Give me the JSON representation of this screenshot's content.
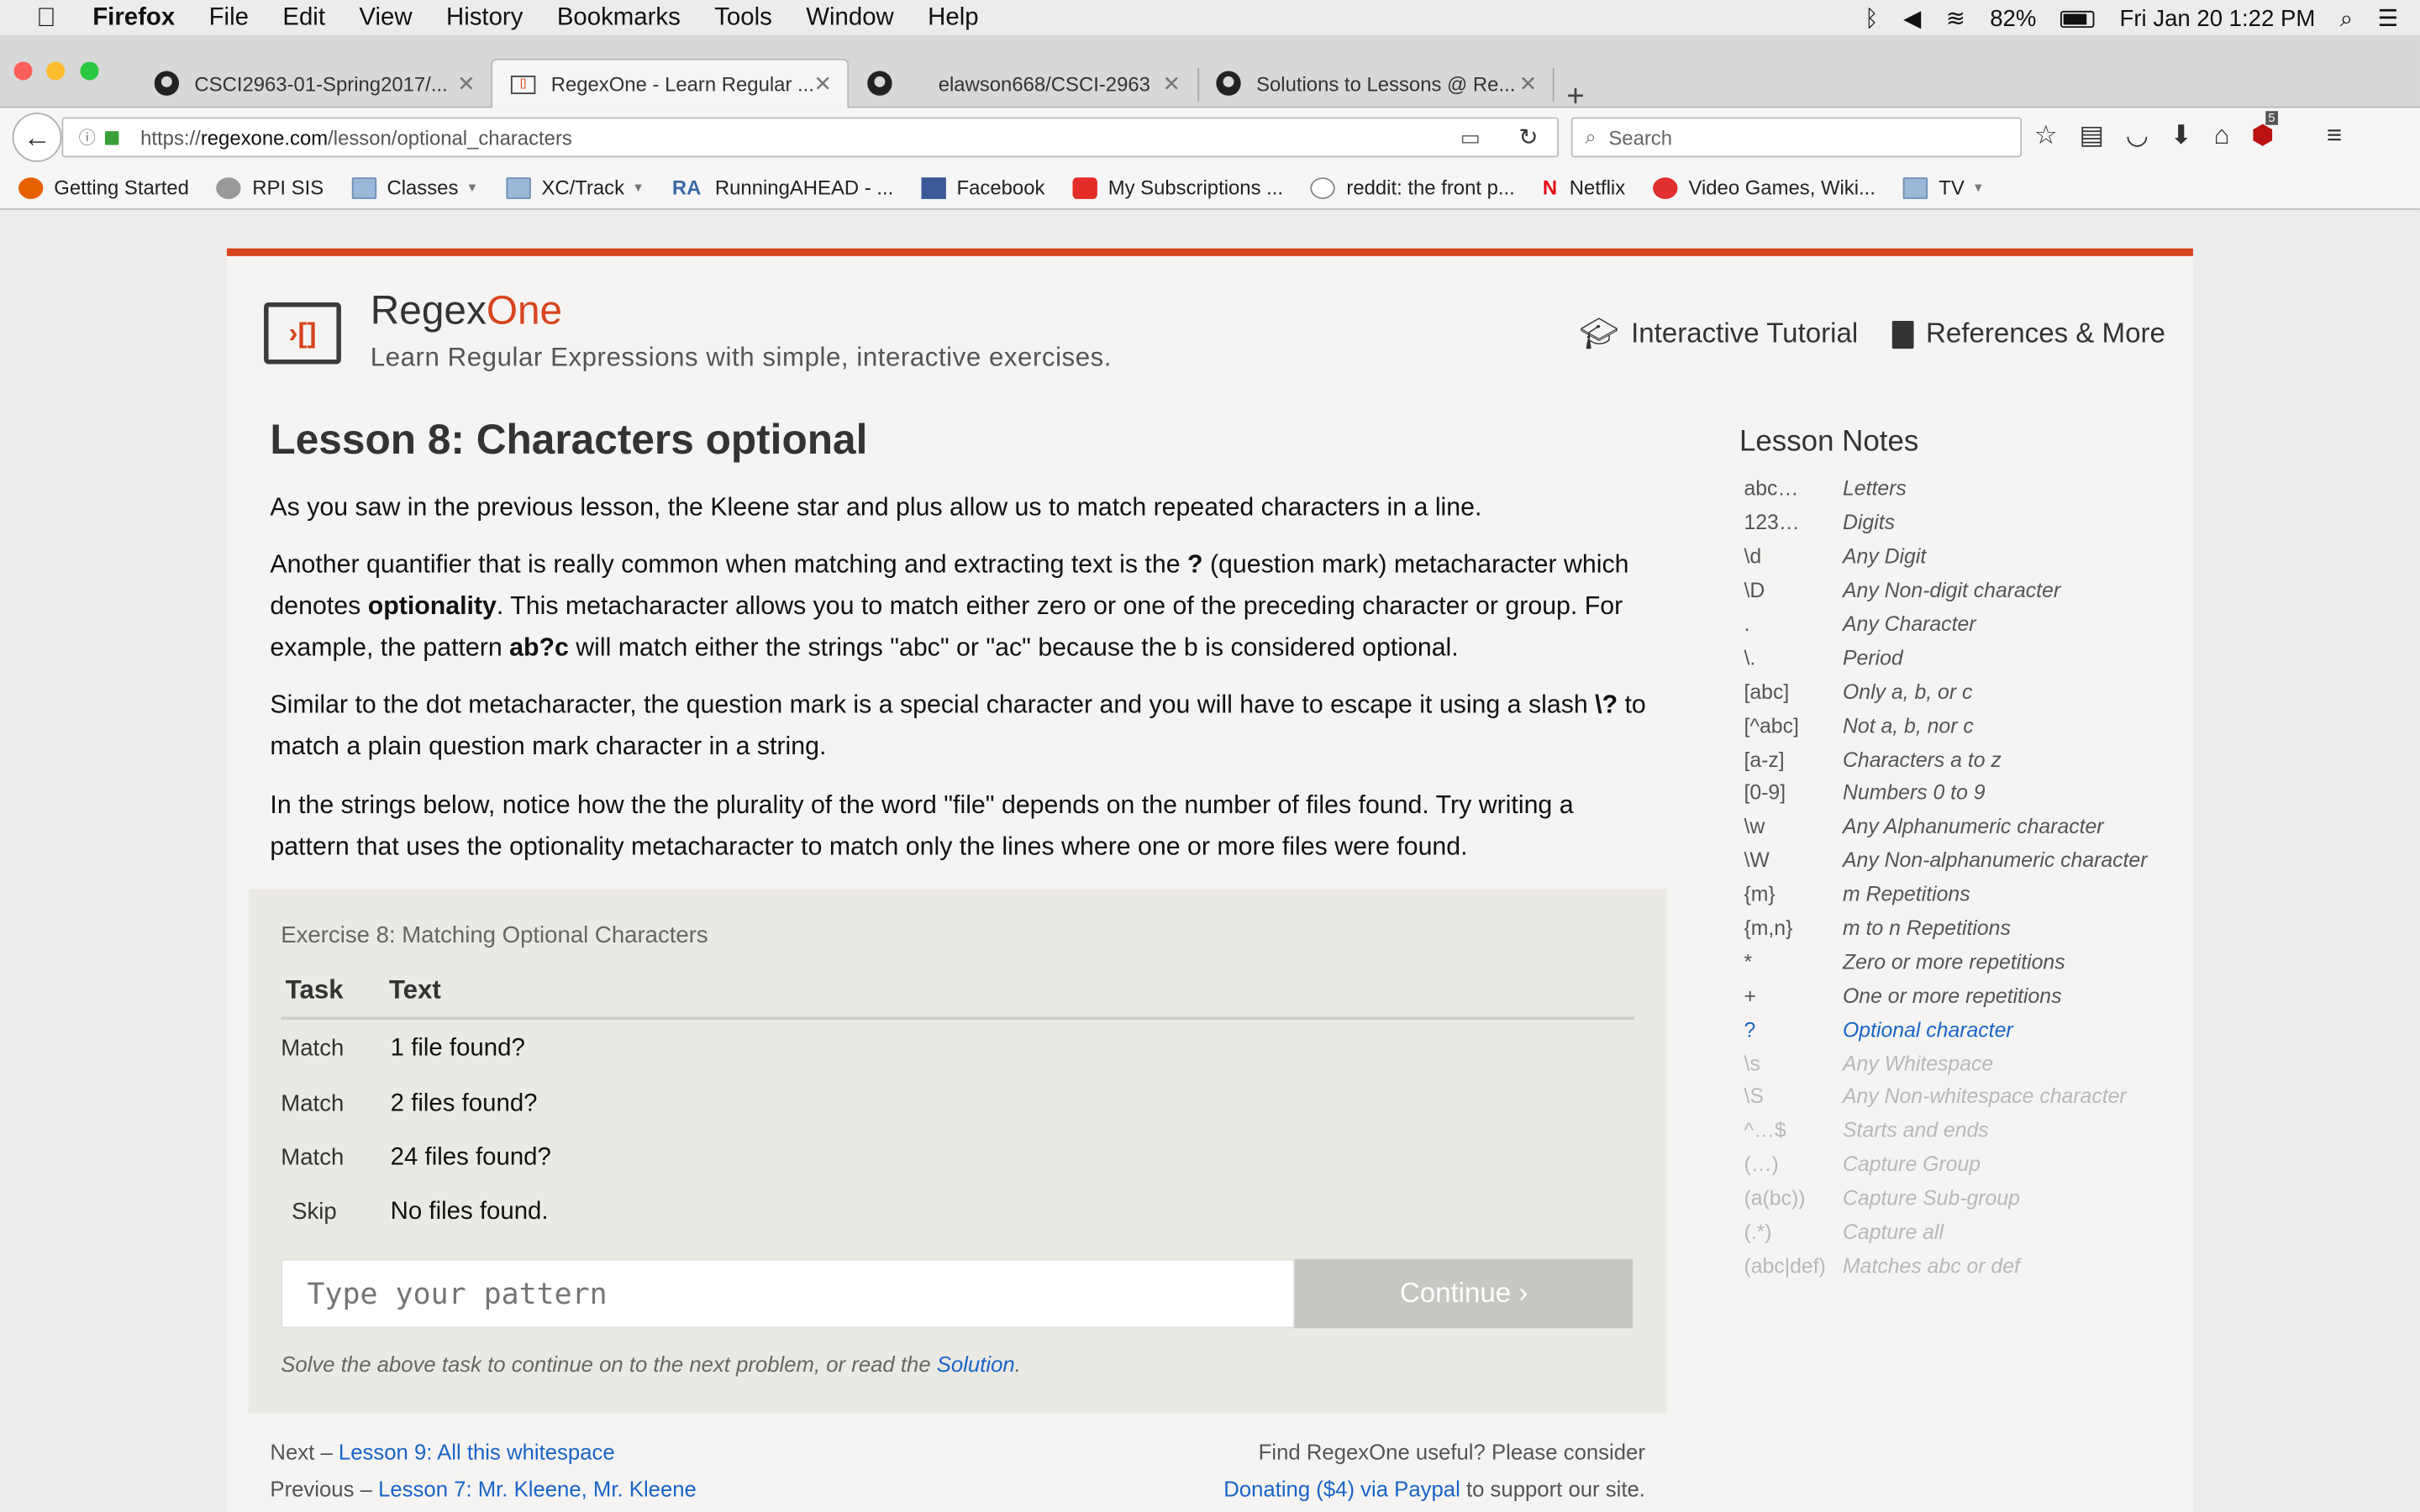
{
  "menubar": {
    "app": "Firefox",
    "items": [
      "File",
      "Edit",
      "View",
      "History",
      "Bookmarks",
      "Tools",
      "Window",
      "Help"
    ],
    "battery": "82%",
    "clock": "Fri Jan 20  1:22 PM"
  },
  "tabs": [
    {
      "title": "CSCI2963-01-Spring2017/...",
      "icon": "github-icon"
    },
    {
      "title": "RegexOne - Learn Regular ...",
      "icon": "regexone-icon"
    },
    {
      "title": "elawson668/CSCI-2963",
      "icon": "github-icon"
    },
    {
      "title": "Solutions to Lessons @ Re...",
      "icon": "github-icon"
    }
  ],
  "nav": {
    "url_prefix": "https://",
    "url_host": "regexone.com",
    "url_path": "/lesson/optional_characters",
    "search_placeholder": "Search",
    "ublock_count": "5"
  },
  "bookmarks": [
    "Getting Started",
    "RPI SIS",
    "Classes",
    "XC/Track",
    "RunningAHEAD - ...",
    "Facebook",
    "My Subscriptions ...",
    "reddit: the front p...",
    "Netflix",
    "Video Games, Wiki...",
    "TV"
  ],
  "site": {
    "brand_a": "Regex",
    "brand_b": "One",
    "tagline": "Learn Regular Expressions with simple, interactive exercises.",
    "nav_tutorial": "Interactive Tutorial",
    "nav_refs": "References & More"
  },
  "lesson": {
    "title": "Lesson 8: Characters optional",
    "p1": "As you saw in the previous lesson, the Kleene star and plus allow us to match repeated characters in a line.",
    "p2a": "Another quantifier that is really common when matching and extracting text is the ",
    "p2q": "?",
    "p2b": " (question mark) metacharacter which denotes ",
    "p2bold": "optionality",
    "p2c": ". This metacharacter allows you to match either zero or one of the preceding character or group. For example, the pattern ",
    "p2pat": "ab?c",
    "p2d": " will match either the strings \"abc\" or \"ac\" because the b is considered optional.",
    "p3a": "Similar to the dot metacharacter, the question mark is a special character and you will have to escape it using a slash ",
    "p3esc": "\\?",
    "p3b": " to match a plain question mark character in a string.",
    "p4": "In the strings below, notice how the the plurality of the word \"file\" depends on the number of files found. Try writing a pattern that uses the optionality metacharacter to match only the lines where one or more files were found."
  },
  "exercise": {
    "title": "Exercise 8: Matching Optional Characters",
    "col_task": "Task",
    "col_text": "Text",
    "rows": [
      {
        "task": "Match",
        "text": "1 file found?"
      },
      {
        "task": "Match",
        "text": "2 files found?"
      },
      {
        "task": "Match",
        "text": "24 files found?"
      },
      {
        "task": "Skip",
        "text": "No files found."
      }
    ],
    "input_placeholder": "Type your pattern",
    "continue_label": "Continue ›",
    "solve_text": "Solve the above task to continue on to the next problem, or read the ",
    "solution_link": "Solution",
    "solve_end": "."
  },
  "footer": {
    "next_prefix": "Next – ",
    "next_link": "Lesson 9: All this whitespace",
    "prev_prefix": "Previous – ",
    "prev_link": "Lesson 7: Mr. Kleene, Mr. Kleene",
    "donate_text": "Find RegexOne useful? Please consider",
    "donate_link": "Donating ($4) via Paypal",
    "donate_end": " to support our site."
  },
  "notes": {
    "title": "Lesson Notes",
    "items": [
      {
        "k": "abc…",
        "v": "Letters",
        "state": "normal"
      },
      {
        "k": "123…",
        "v": "Digits",
        "state": "normal"
      },
      {
        "k": "\\d",
        "v": "Any Digit",
        "state": "normal"
      },
      {
        "k": "\\D",
        "v": "Any Non-digit character",
        "state": "normal"
      },
      {
        "k": ".",
        "v": "Any Character",
        "state": "normal"
      },
      {
        "k": "\\.",
        "v": "Period",
        "state": "normal"
      },
      {
        "k": "[abc]",
        "v": "Only a, b, or c",
        "state": "normal"
      },
      {
        "k": "[^abc]",
        "v": "Not a, b, nor c",
        "state": "normal"
      },
      {
        "k": "[a-z]",
        "v": "Characters a to z",
        "state": "normal"
      },
      {
        "k": "[0-9]",
        "v": "Numbers 0 to 9",
        "state": "normal"
      },
      {
        "k": "\\w",
        "v": "Any Alphanumeric character",
        "state": "normal"
      },
      {
        "k": "\\W",
        "v": "Any Non-alphanumeric character",
        "state": "normal"
      },
      {
        "k": "{m}",
        "v": "m Repetitions",
        "state": "normal"
      },
      {
        "k": "{m,n}",
        "v": "m to n Repetitions",
        "state": "normal"
      },
      {
        "k": "*",
        "v": "Zero or more repetitions",
        "state": "normal"
      },
      {
        "k": "+",
        "v": "One or more repetitions",
        "state": "normal"
      },
      {
        "k": "?",
        "v": "Optional character",
        "state": "current"
      },
      {
        "k": "\\s",
        "v": "Any Whitespace",
        "state": "dim"
      },
      {
        "k": "\\S",
        "v": "Any Non-whitespace character",
        "state": "dim"
      },
      {
        "k": "^…$",
        "v": "Starts and ends",
        "state": "dim"
      },
      {
        "k": "(…)",
        "v": "Capture Group",
        "state": "dim"
      },
      {
        "k": "(a(bc))",
        "v": "Capture Sub-group",
        "state": "dim"
      },
      {
        "k": "(.*)",
        "v": "Capture all",
        "state": "dim"
      },
      {
        "k": "(abc|def)",
        "v": "Matches abc or def",
        "state": "dim"
      }
    ]
  },
  "colors": {
    "accent": "#d8441e",
    "link": "#1a64c8"
  }
}
